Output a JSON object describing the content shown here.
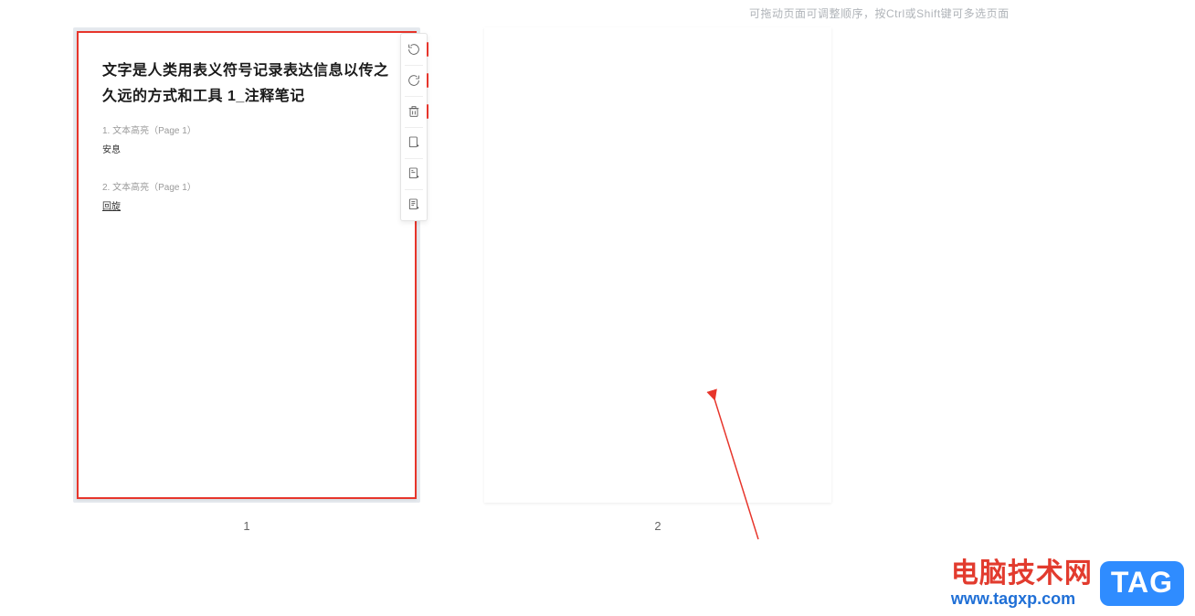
{
  "hint": "可拖动页面可调整顺序，按Ctrl或Shift键可多选页面",
  "page1": {
    "number": "1",
    "title": "文字是人类用表义符号记录表达信息以传之久远的方式和工具 1_注释笔记",
    "note1_head": "1. 文本高亮（Page 1）",
    "note1_body": "安息",
    "note2_head": "2. 文本高亮（Page 1）",
    "note2_body": "回旋"
  },
  "page2": {
    "number": "2"
  },
  "toolbar": {
    "rotate_cw": "rotate-clockwise",
    "rotate_ccw": "rotate-counterclockwise",
    "delete": "delete",
    "insert_blank": "insert-blank-page",
    "insert_image": "insert-image-page",
    "insert_file": "insert-from-file"
  },
  "watermark": {
    "cn": "电脑技术网",
    "url": "www.tagxp.com",
    "tag": "TAG"
  }
}
